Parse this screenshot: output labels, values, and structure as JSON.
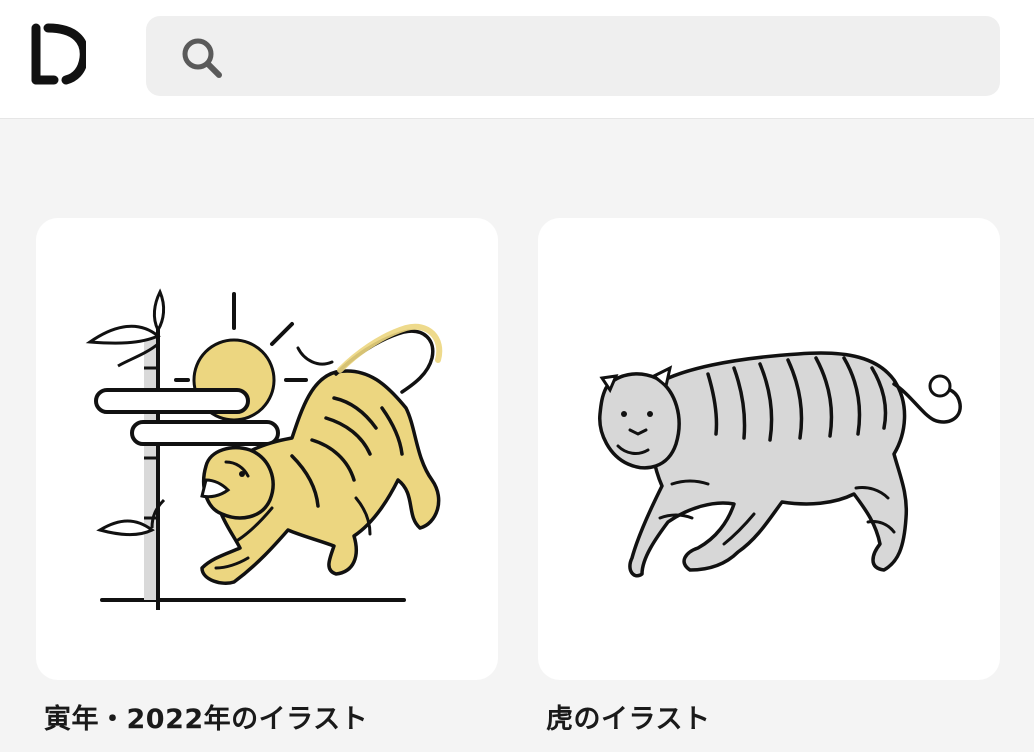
{
  "header": {
    "logo_icon": "d-logo-icon",
    "search_icon": "search-icon",
    "search_value": "",
    "search_placeholder": ""
  },
  "cards": [
    {
      "title": "寅年・2022年のイラスト",
      "image_icon": "tiger-sun-bamboo-illustration",
      "accent": "#ecd680"
    },
    {
      "title": "虎のイラスト",
      "image_icon": "walking-tiger-illustration",
      "accent": "#d7d7d7"
    }
  ],
  "colors": {
    "page_background": "#f4f4f4",
    "card_background": "#ffffff",
    "search_background": "#efefef",
    "ink": "#111111"
  }
}
